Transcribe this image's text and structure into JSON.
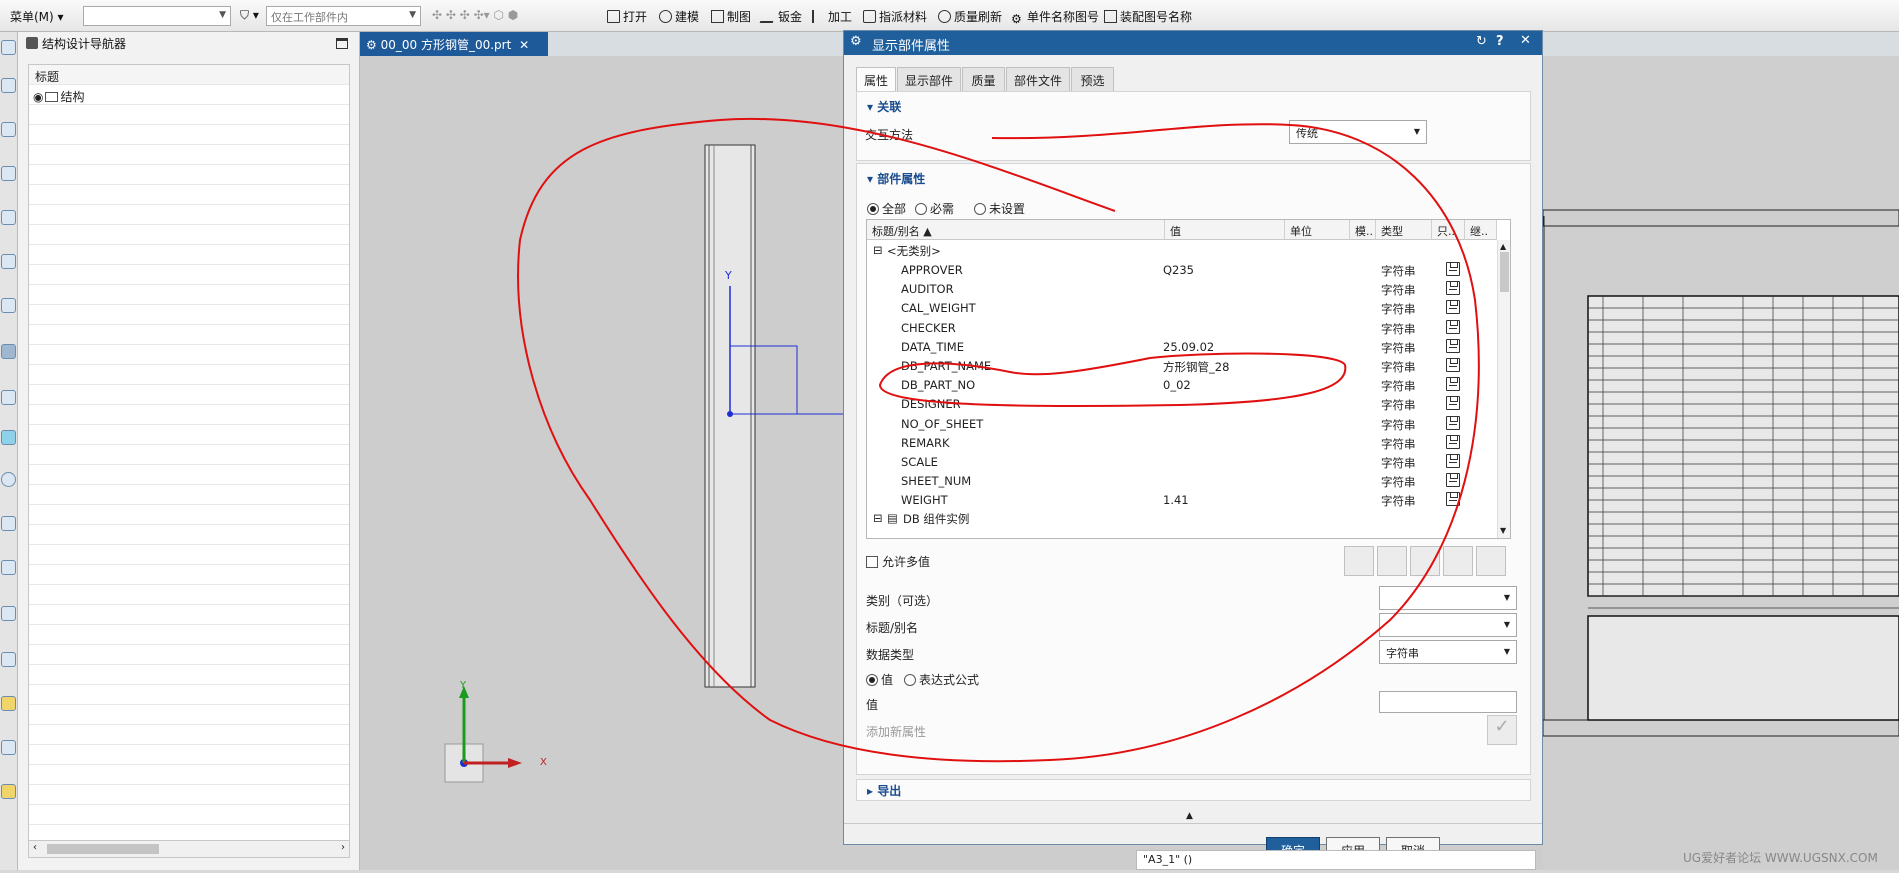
{
  "toolbar": {
    "menu_label": "菜单(M)",
    "selection_filter_value": "",
    "scope_filter_value": "仅在工作部件内",
    "items": [
      "打开",
      "建模",
      "制图",
      "钣金",
      "加工",
      "指派材料",
      "质量刷新",
      "单件名称图号",
      "装配图号名称"
    ]
  },
  "navigator": {
    "title": "结构设计导航器",
    "column_header": "标题",
    "tree_root": "结构"
  },
  "document_tab": {
    "label": "00_00 方形钢管_00.prt"
  },
  "viewport": {
    "axis_y": "Y",
    "triad_y": "Y",
    "triad_x": "X"
  },
  "dialog": {
    "title": "显示部件属性",
    "tabs": [
      "属性",
      "显示部件",
      "质量",
      "部件文件",
      "预选"
    ],
    "active_tab": "属性",
    "relation_section": {
      "header": "关联",
      "interaction_label": "交互方法",
      "interaction_value": "传统"
    },
    "part_attributes": {
      "header": "部件属性",
      "filters": [
        "全部",
        "必需",
        "未设置"
      ],
      "selected_filter": "全部",
      "columns": [
        "标题/别名",
        "值",
        "单位",
        "模..",
        "类型",
        "只..",
        "继.."
      ],
      "category_nocat": "<无类别>",
      "rows": [
        {
          "title": "APPROVER",
          "value": "Q235",
          "type": "字符串"
        },
        {
          "title": "AUDITOR",
          "value": "",
          "type": "字符串"
        },
        {
          "title": "CAL_WEIGHT",
          "value": "",
          "type": "字符串"
        },
        {
          "title": "CHECKER",
          "value": "",
          "type": "字符串"
        },
        {
          "title": "DATA_TIME",
          "value": "25.09.02",
          "type": "字符串"
        },
        {
          "title": "DB_PART_NAME",
          "value": "方形钢管_28",
          "type": "字符串"
        },
        {
          "title": "DB_PART_NO",
          "value": "0_02",
          "type": "字符串"
        },
        {
          "title": "DESIGNER",
          "value": "",
          "type": "字符串"
        },
        {
          "title": "NO_OF_SHEET",
          "value": "",
          "type": "字符串"
        },
        {
          "title": "REMARK",
          "value": "",
          "type": "字符串"
        },
        {
          "title": "SCALE",
          "value": "",
          "type": "字符串"
        },
        {
          "title": "SHEET_NUM",
          "value": "",
          "type": "字符串"
        },
        {
          "title": "WEIGHT",
          "value": "1.41",
          "type": "字符串"
        }
      ],
      "category_db": "DB 组件实例",
      "allow_multi": "允许多值",
      "category_label": "类别（可选）",
      "title_alias_label": "标题/别名",
      "data_type_label": "数据类型",
      "data_type_value": "字符串",
      "value_modes": [
        "值",
        "表达式公式"
      ],
      "selected_value_mode": "值",
      "value_label": "值",
      "add_new": "添加新属性"
    },
    "export_section": "导出",
    "buttons": {
      "ok": "确定",
      "apply": "应用",
      "cancel": "取消"
    }
  },
  "status_bar": "\"A3_1\" ()",
  "watermark": "UG爱好者论坛 WWW.UGSNX.COM",
  "colors": {
    "accent": "#1e5f9c",
    "annotation_red": "#e01010",
    "axis_blue": "#1f2fd6",
    "triad_green": "#1b9a1b"
  }
}
